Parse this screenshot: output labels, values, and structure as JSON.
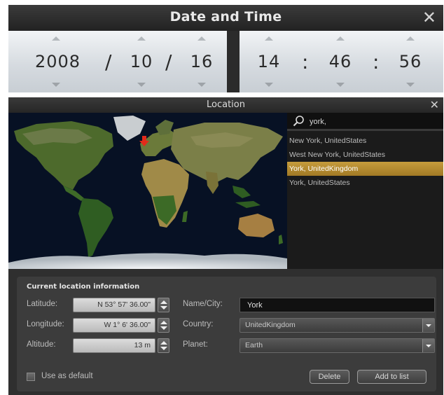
{
  "datetime": {
    "title": "Date and Time",
    "close_icon": "close-icon",
    "year": "2008",
    "month": "10",
    "day": "16",
    "date_separator": "/",
    "hour": "14",
    "minute": "46",
    "second": "56",
    "time_separator": ":"
  },
  "location": {
    "title": "Location",
    "close_icon": "close-icon",
    "search": {
      "icon": "search-icon",
      "value": "york,"
    },
    "results": [
      {
        "label": "New York, UnitedStates"
      },
      {
        "label": "West New York, UnitedStates"
      },
      {
        "label": "York, UnitedKingdom"
      },
      {
        "label": "York, UnitedStates"
      }
    ],
    "selected_result_index": 2,
    "map_marker_icon": "red-arrow-marker-icon",
    "info": {
      "title": "Current location information",
      "latitude_label": "Latitude:",
      "latitude_value": "N 53° 57' 36.00\"",
      "longitude_label": "Longitude:",
      "longitude_value": "W 1° 6' 36.00\"",
      "altitude_label": "Altitude:",
      "altitude_value": "13 m",
      "name_label": "Name/City:",
      "name_value": "York",
      "country_label": "Country:",
      "country_value": "UnitedKingdom",
      "planet_label": "Planet:",
      "planet_value": "Earth",
      "default_label": "Use as default",
      "default_checked": false,
      "delete_label": "Delete",
      "add_label": "Add to list"
    }
  },
  "colors": {
    "selected_result": "#b8902f",
    "dark_panel": "#2f2f2f",
    "ocean": "#071124"
  }
}
